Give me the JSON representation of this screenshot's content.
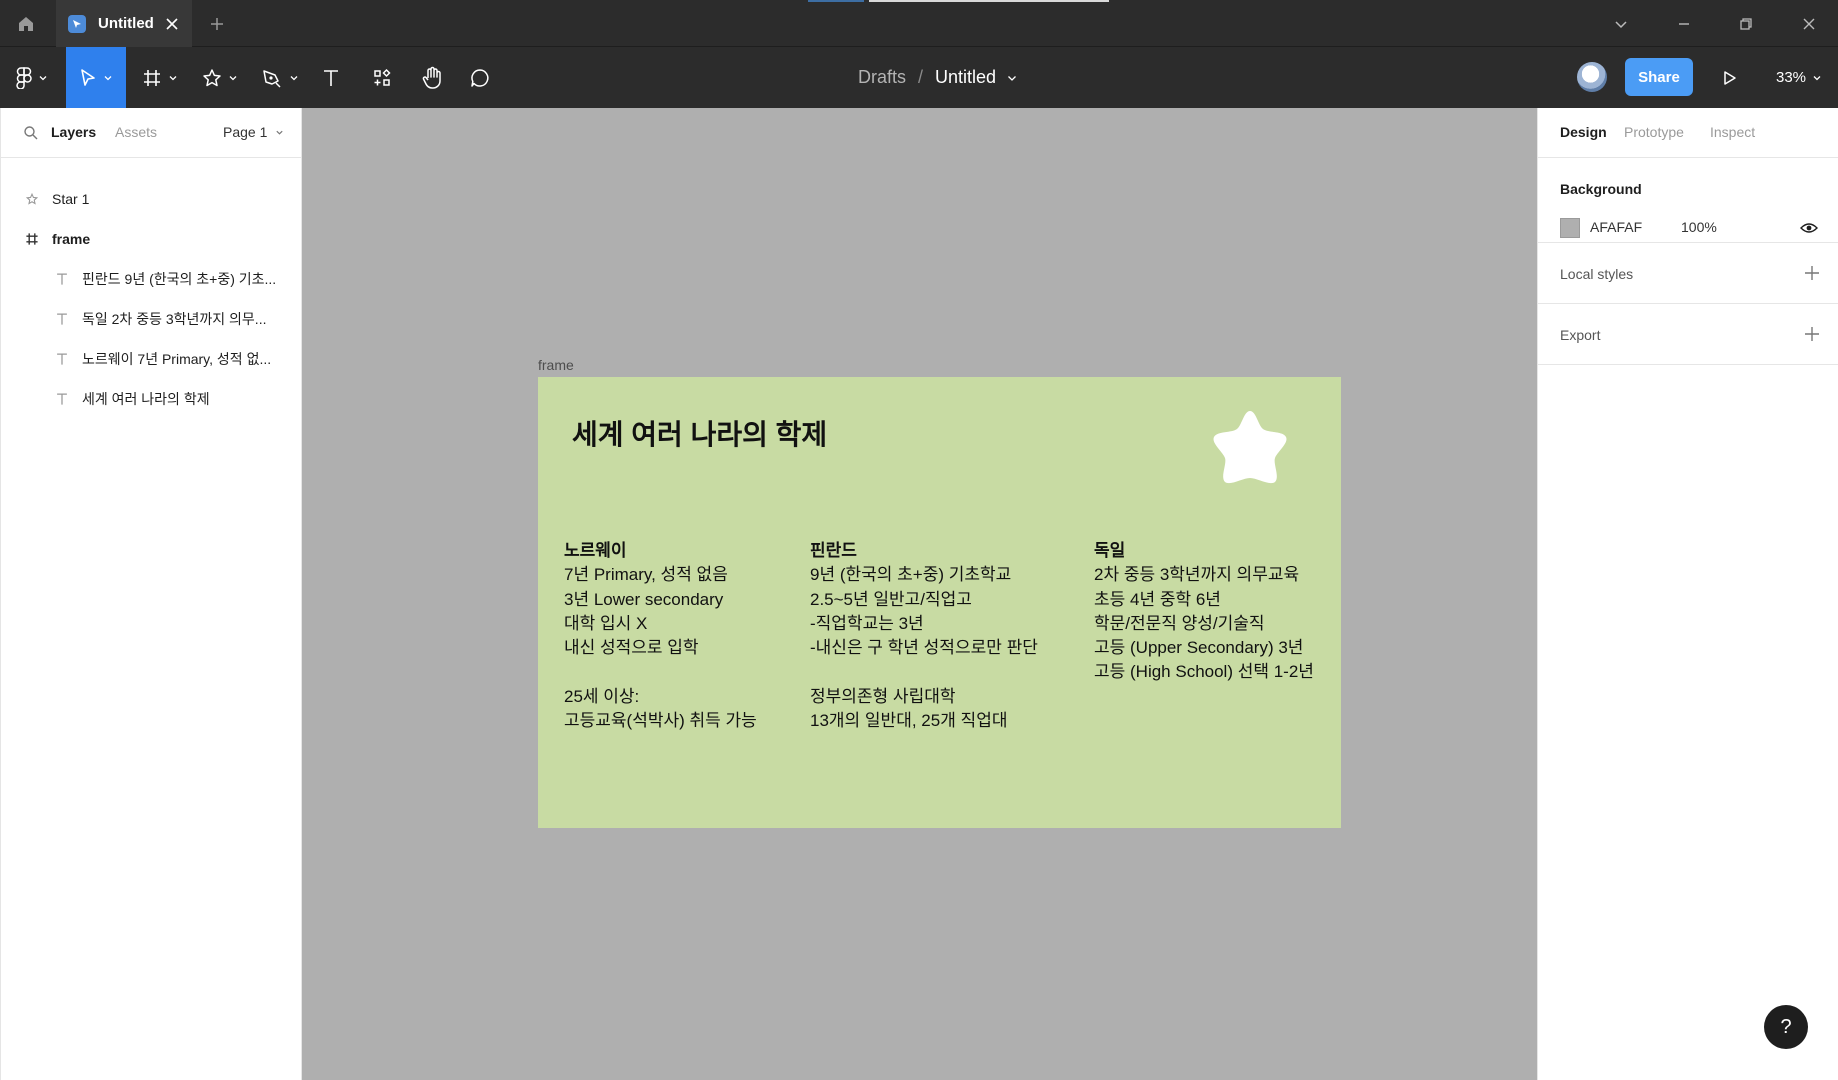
{
  "titlebar": {
    "tab_title": "Untitled"
  },
  "toolbar": {
    "breadcrumb_parent": "Drafts",
    "breadcrumb_separator": "/",
    "file_name": "Untitled",
    "share_label": "Share",
    "zoom_label": "33%"
  },
  "left_panel": {
    "tabs": {
      "layers": "Layers",
      "assets": "Assets"
    },
    "page_selector": "Page 1",
    "layers": [
      {
        "label": "Star 1",
        "icon": "star-icon"
      },
      {
        "label": "frame",
        "icon": "frame-icon"
      },
      {
        "label": "핀란드 9년 (한국의 초+중) 기초...",
        "icon": "text-icon"
      },
      {
        "label": "독일 2차 중등 3학년까지 의무...",
        "icon": "text-icon"
      },
      {
        "label": "노르웨이 7년 Primary, 성적 없...",
        "icon": "text-icon"
      },
      {
        "label": "세계 여러 나라의 학제",
        "icon": "text-icon"
      }
    ]
  },
  "canvas": {
    "frame_label": "frame",
    "background_color": "#AFAFAF",
    "frame_fill": "#C8DBA3",
    "title": "세계 여러 나라의 학제",
    "columns": [
      {
        "heading": "노르웨이",
        "lines": [
          "7년 Primary, 성적 없음",
          "3년 Lower secondary",
          "대학 입시 X",
          "내신 성적으로 입학",
          "",
          "25세 이상:",
          "고등교육(석박사) 취득 가능"
        ]
      },
      {
        "heading": "핀란드",
        "lines": [
          "9년 (한국의 초+중) 기초학교",
          "2.5~5년 일반고/직업고",
          "-직업학교는 3년",
          "-내신은 구 학년 성적으로만 판단",
          "",
          "정부의존형 사립대학",
          "13개의 일반대, 25개 직업대"
        ]
      },
      {
        "heading": "독일",
        "lines": [
          "2차 중등 3학년까지 의무교육",
          "초등 4년 중학 6년",
          "학문/전문직 양성/기술직",
          "고등 (Upper Secondary) 3년",
          "고등 (High School) 선택 1-2년"
        ]
      }
    ]
  },
  "right_panel": {
    "tabs": {
      "design": "Design",
      "prototype": "Prototype",
      "inspect": "Inspect"
    },
    "background_title": "Background",
    "background_hex": "AFAFAF",
    "background_opacity": "100%",
    "local_styles": "Local styles",
    "export": "Export"
  },
  "help_label": "?"
}
